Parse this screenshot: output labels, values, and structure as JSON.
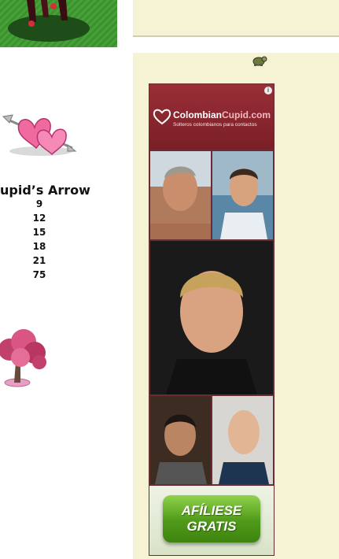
{
  "item": {
    "title": "upid’s Arrow",
    "numbers": [
      "9",
      "12",
      "15",
      "18",
      "21",
      "75"
    ]
  },
  "ad": {
    "brand": "ColombianCupid.com",
    "brand_part1": "Colombian",
    "brand_part2": "Cupid.com",
    "tagline": "Solteros colombianos para contactos",
    "info_icon": "i",
    "cta_line1": "AFÍLIESE",
    "cta_line2": "GRATIS",
    "colors": {
      "header": "#8b2a32",
      "cta": "#5aa421",
      "sidebar": "#f5f3d3"
    }
  }
}
